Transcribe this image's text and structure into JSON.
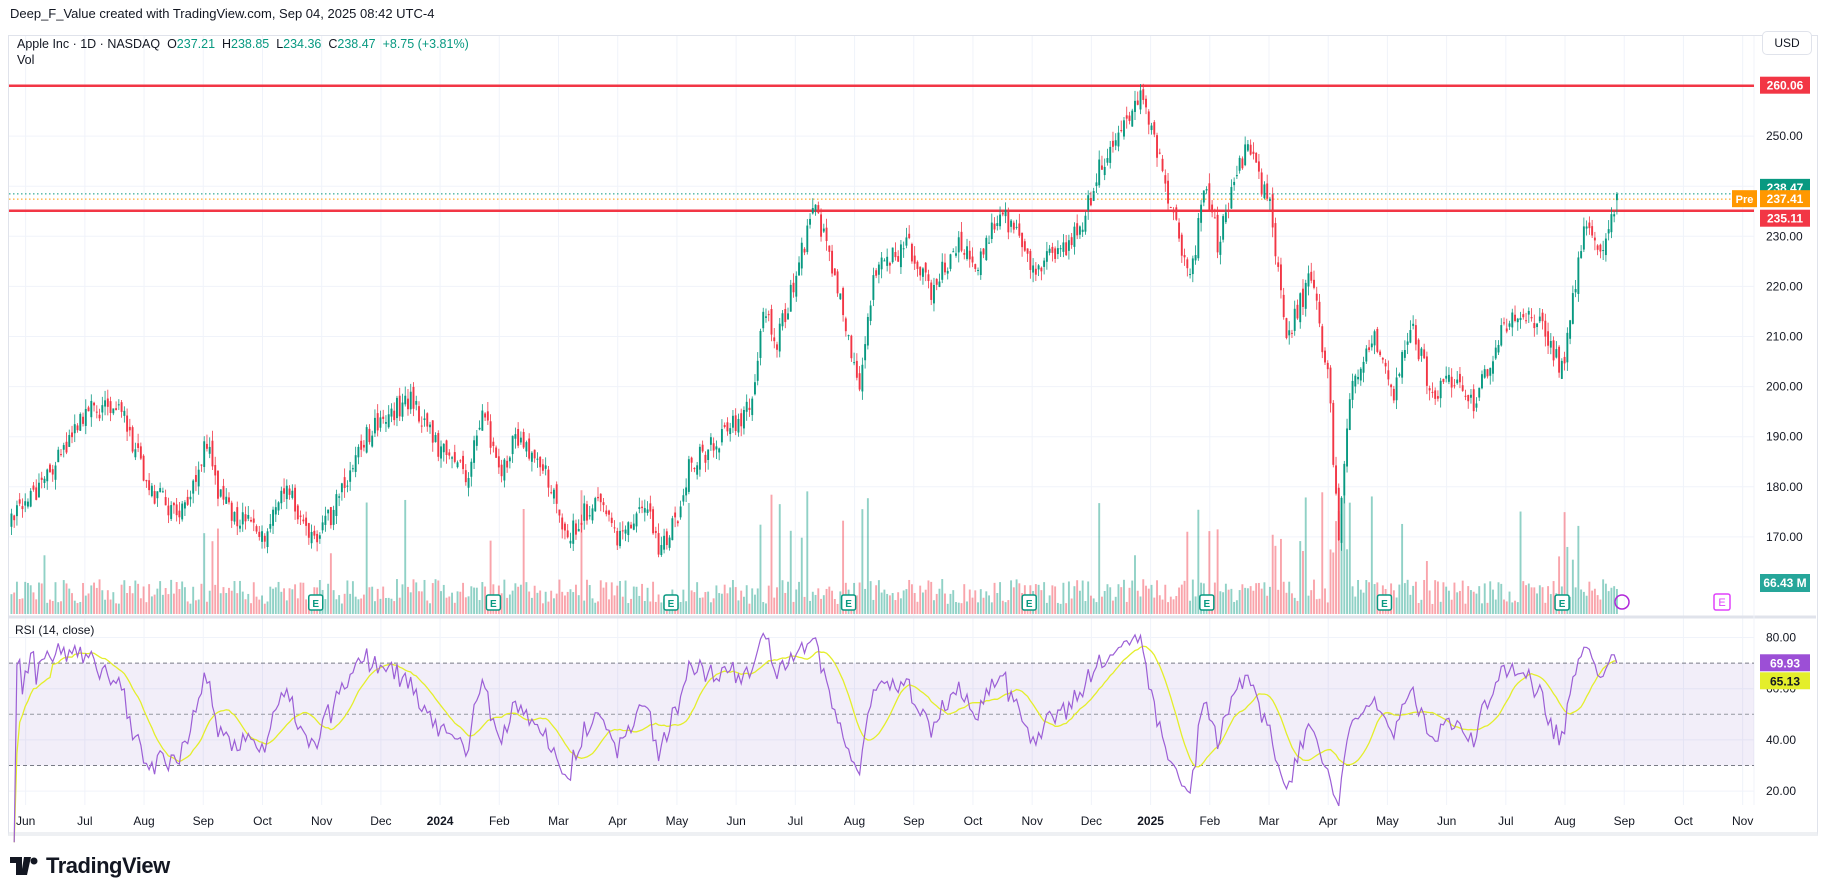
{
  "credit": "Deep_F_Value created with TradingView.com, Sep 04, 2025 08:42 UTC-4",
  "legend": {
    "symbol": "Apple Inc · 1D · NASDAQ",
    "o_label": "O",
    "o": "237.21",
    "h_label": "H",
    "h": "238.85",
    "l_label": "L",
    "l": "234.36",
    "c_label": "C",
    "c": "238.47",
    "change": "+8.75 (+3.81%)",
    "vol": "Vol"
  },
  "currency": "USD",
  "rsi_title": "RSI (14, close)",
  "logo": "TradingView",
  "colors": {
    "up": "#089981",
    "down": "#f23645",
    "rsi": "#9c5fd6",
    "rsi_ma": "#e4ee2b",
    "level": "#f23645",
    "pre": "#ff9800"
  },
  "chart_data": {
    "type": "candlestick",
    "symbol": "AAPL",
    "price_axis": {
      "ticks": [
        170,
        180,
        190,
        200,
        210,
        220,
        230,
        240,
        250
      ],
      "tick_labels": [
        "170.00",
        "180.00",
        "190.00",
        "200.00",
        "210.00",
        "220.00",
        "230.00",
        "240.00",
        "250.00"
      ],
      "range": [
        160,
        270
      ]
    },
    "time_axis": {
      "labels": [
        "Jun",
        "Jul",
        "Aug",
        "Sep",
        "Oct",
        "Nov",
        "Dec",
        "2024",
        "Feb",
        "Mar",
        "Apr",
        "May",
        "Jun",
        "Jul",
        "Aug",
        "Sep",
        "Oct",
        "Nov",
        "Dec",
        "2025",
        "Feb",
        "Mar",
        "Apr",
        "May",
        "Jun",
        "Jul",
        "Aug",
        "Sep",
        "Oct",
        "Nov"
      ],
      "bold": [
        "2024",
        "2025"
      ]
    },
    "price_path_note": "anchors [months since 2023-06-01, close]",
    "price_path": [
      [
        -0.24,
        172.5
      ],
      [
        0.2,
        180
      ],
      [
        0.6,
        186
      ],
      [
        1.04,
        194.6
      ],
      [
        1.54,
        197
      ],
      [
        2.1,
        179.5
      ],
      [
        2.6,
        174
      ],
      [
        3.07,
        189
      ],
      [
        3.3,
        177
      ],
      [
        4.0,
        170
      ],
      [
        4.4,
        180.7
      ],
      [
        4.9,
        168
      ],
      [
        5.8,
        191
      ],
      [
        6.5,
        198
      ],
      [
        7.05,
        186.5
      ],
      [
        7.45,
        182
      ],
      [
        7.74,
        194.7
      ],
      [
        8.03,
        182
      ],
      [
        8.23,
        190
      ],
      [
        8.82,
        182
      ],
      [
        9.11,
        170
      ],
      [
        9.6,
        177
      ],
      [
        10.0,
        170
      ],
      [
        10.5,
        176
      ],
      [
        10.7,
        167
      ],
      [
        10.99,
        173.7
      ],
      [
        11.2,
        184
      ],
      [
        11.78,
        190
      ],
      [
        12.27,
        196
      ],
      [
        12.46,
        216.7
      ],
      [
        12.66,
        207.4
      ],
      [
        13.25,
        233
      ],
      [
        13.35,
        235
      ],
      [
        13.74,
        219
      ],
      [
        14.07,
        199
      ],
      [
        14.33,
        223.7
      ],
      [
        14.92,
        228
      ],
      [
        15.31,
        219
      ],
      [
        15.71,
        228.4
      ],
      [
        16.1,
        225
      ],
      [
        16.5,
        235.3
      ],
      [
        16.99,
        223.7
      ],
      [
        17.38,
        226
      ],
      [
        17.78,
        230.7
      ],
      [
        18.17,
        244.7
      ],
      [
        18.86,
        258.6
      ],
      [
        19.25,
        240
      ],
      [
        19.45,
        230.7
      ],
      [
        19.65,
        221.4
      ],
      [
        19.94,
        240
      ],
      [
        20.14,
        228.4
      ],
      [
        20.63,
        248.6
      ],
      [
        21.02,
        235.3
      ],
      [
        21.32,
        209.8
      ],
      [
        21.71,
        222.6
      ],
      [
        22.01,
        200.5
      ],
      [
        22.17,
        170.2
      ],
      [
        22.4,
        200.5
      ],
      [
        22.8,
        209.8
      ],
      [
        23.09,
        197
      ],
      [
        23.39,
        212
      ],
      [
        23.78,
        198
      ],
      [
        24.17,
        202.8
      ],
      [
        24.47,
        197
      ],
      [
        24.96,
        213
      ],
      [
        25.55,
        213
      ],
      [
        25.95,
        202.8
      ],
      [
        26.14,
        219
      ],
      [
        26.34,
        233
      ],
      [
        26.57,
        226
      ],
      [
        26.91,
        238.47
      ]
    ],
    "last": {
      "open": 237.21,
      "high": 238.85,
      "low": 234.36,
      "close": 238.47
    },
    "price_labels": [
      {
        "label": "260.06",
        "value": 260.06,
        "kind": "level"
      },
      {
        "label": "238.47",
        "value": 238.47,
        "kind": "last"
      },
      {
        "label": "237.41",
        "value": 237.41,
        "kind": "pre",
        "tag": "Pre"
      },
      {
        "label": "235.11",
        "value": 235.11,
        "kind": "level"
      }
    ],
    "horizontal_levels": [
      260.06,
      235.11
    ],
    "volume": {
      "last_label": "66.43 M",
      "earnings_marker": "E",
      "earnings_months": [
        4.9,
        7.9,
        10.9,
        13.9,
        16.95,
        19.95,
        22.95,
        25.95
      ]
    },
    "rsi": {
      "period": 14,
      "ma_period": 14,
      "ticks": [
        20,
        40,
        60,
        80
      ],
      "tick_labels": [
        "20.00",
        "40.00",
        "60.00",
        "80.00"
      ],
      "bands": [
        30,
        50,
        70
      ],
      "last_label": "69.93",
      "ma_last_label": "65.13"
    }
  }
}
